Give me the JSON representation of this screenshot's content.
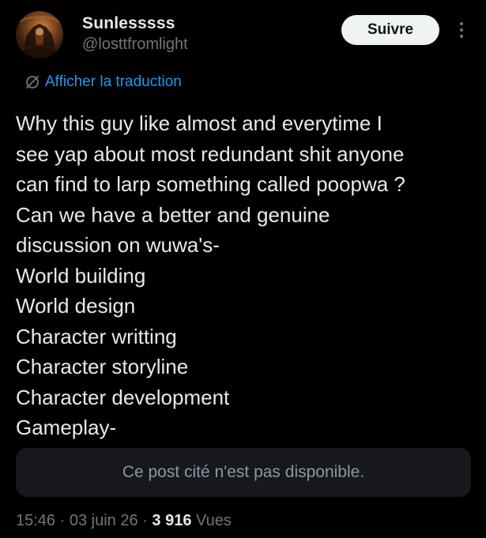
{
  "author": {
    "display_name": "Sunlesssss",
    "handle": "@losttfromlight",
    "avatar_icon": "avatar-image"
  },
  "header": {
    "follow_label": "Suivre",
    "more_icon": "more-vertical-icon"
  },
  "translate": {
    "icon": "globe-slash-icon",
    "label": "Afficher la traduction",
    "color": "#1d9bf0"
  },
  "post": {
    "lines": [
      "Why this guy like almost and everytime I",
      "see yap about most redundant shit anyone",
      "can find to larp something called poopwa ?",
      "Can we have a better and genuine",
      "discussion on wuwa's-",
      "World building",
      "World design",
      "Character writting",
      "Character storyline",
      "Character development",
      "Gameplay-"
    ]
  },
  "quote": {
    "unavailable_text": "Ce post cité n'est pas disponible."
  },
  "meta": {
    "time": "15:46",
    "separator": "·",
    "date": "03 juin 26",
    "views_count": "3 916",
    "views_label": "Vues"
  },
  "colors": {
    "background": "#000000",
    "text_primary": "#e7e9ea",
    "text_secondary": "#71767b",
    "link": "#1d9bf0",
    "button_bg": "#eff3f4",
    "card_bg": "#16181c"
  }
}
